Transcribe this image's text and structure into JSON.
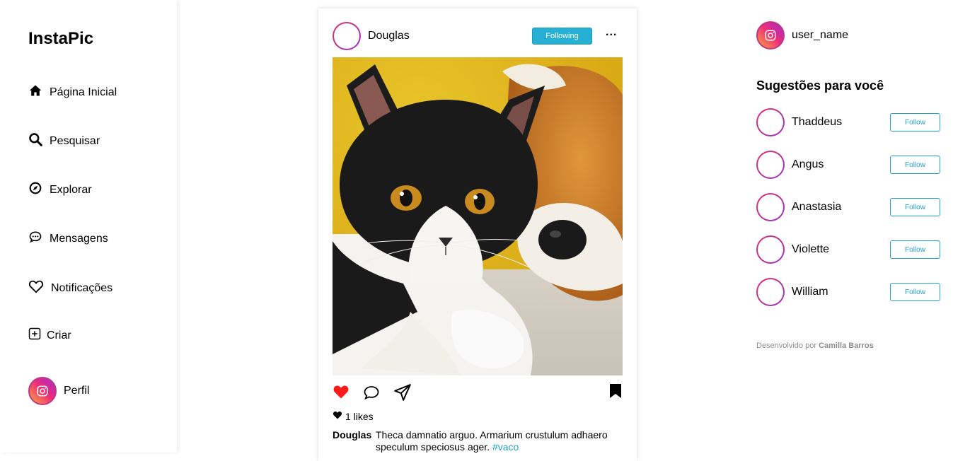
{
  "brand": {
    "logo": "InstaPic",
    "accent": "#26b0d4"
  },
  "nav": {
    "items": [
      {
        "label": "Página Inicial",
        "icon": "home-icon"
      },
      {
        "label": "Pesquisar",
        "icon": "search-icon"
      },
      {
        "label": "Explorar",
        "icon": "compass-icon"
      },
      {
        "label": "Mensagens",
        "icon": "chat-icon"
      },
      {
        "label": "Notificações",
        "icon": "heart-icon"
      },
      {
        "label": "Criar",
        "icon": "plus-square-icon"
      },
      {
        "label": "Perfil",
        "icon": "instagram-avatar-icon"
      }
    ]
  },
  "post": {
    "user": "Douglas",
    "following_label": "Following",
    "more_label": "...",
    "image": "black-and-white-kitten-with-plush-fox",
    "liked": true,
    "likes_label": "1 likes",
    "caption_user": "Douglas",
    "caption_text": "Theca damnatio arguo. Armarium crustulum adhaero speculum speciosus ager.",
    "caption_tag": "#vaco"
  },
  "profile": {
    "username": "user_name"
  },
  "suggestions": {
    "title": "Sugestões para você",
    "follow_label": "Follow",
    "users": [
      "Thaddeus",
      "Angus",
      "Anastasia",
      "Violette",
      "William"
    ]
  },
  "footer": {
    "credit_prefix": "Desenvolvido por",
    "credit_name": "Camilla Barros"
  }
}
